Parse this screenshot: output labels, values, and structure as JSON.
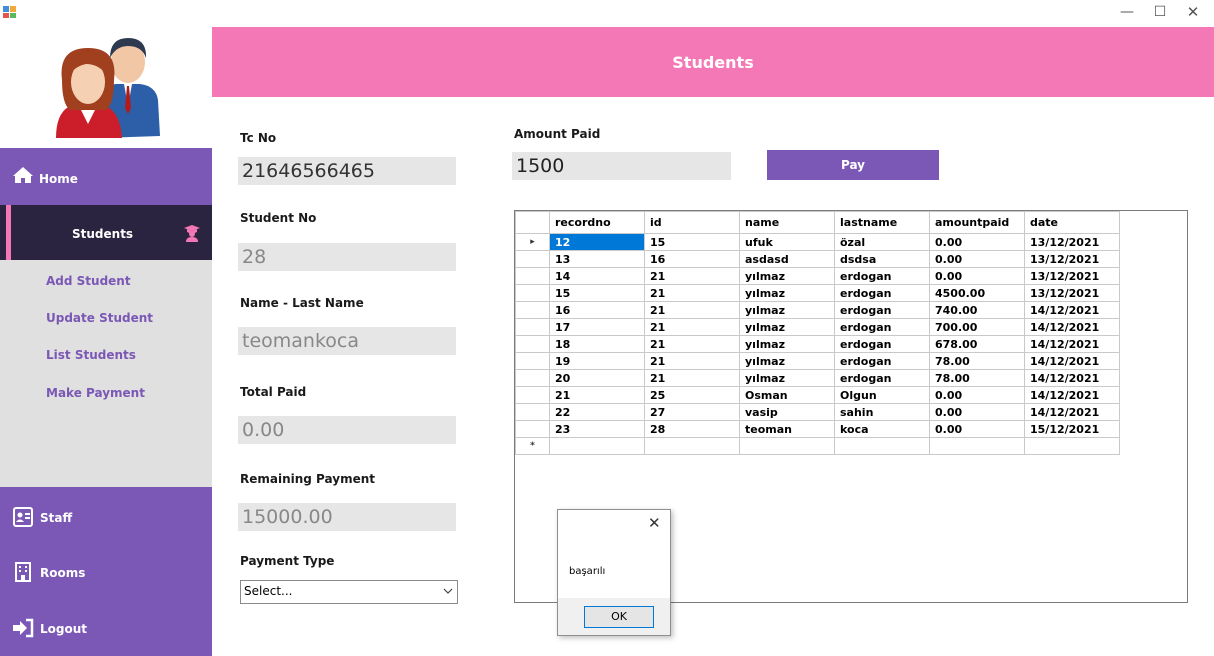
{
  "window": {
    "minimize_glyph": "—",
    "maximize_glyph": "☐",
    "close_glyph": "✕"
  },
  "header": {
    "title": "Students"
  },
  "sidebar": {
    "home": "Home",
    "students": "Students",
    "submenu": [
      "Add Student",
      "Update Student",
      "List Students",
      "Make Payment"
    ],
    "bottom": [
      "Staff",
      "Rooms",
      "Logout"
    ]
  },
  "form": {
    "tc_no_label": "Tc No",
    "tc_no_value": "21646566465",
    "student_no_label": "Student No",
    "student_no_value": "28",
    "name_label": "Name - Last Name",
    "name_value": "teomankoca",
    "total_paid_label": "Total Paid",
    "total_paid_value": "0.00",
    "remaining_label": "Remaining Payment",
    "remaining_value": "15000.00",
    "payment_type_label": "Payment Type",
    "payment_type_value": "Select...",
    "amount_paid_label": "Amount Paid",
    "amount_paid_value": "1500",
    "pay_button": "Pay"
  },
  "grid": {
    "columns": [
      "recordno",
      "id",
      "name",
      "lastname",
      "amountpaid",
      "date"
    ],
    "rows": [
      [
        "12",
        "15",
        "ufuk",
        "özal",
        "0.00",
        "13/12/2021"
      ],
      [
        "13",
        "16",
        "asdasd",
        "dsdsa",
        "0.00",
        "13/12/2021"
      ],
      [
        "14",
        "21",
        "yılmaz",
        "erdogan",
        "0.00",
        "13/12/2021"
      ],
      [
        "15",
        "21",
        "yılmaz",
        "erdogan",
        "4500.00",
        "13/12/2021"
      ],
      [
        "16",
        "21",
        "yılmaz",
        "erdogan",
        "740.00",
        "14/12/2021"
      ],
      [
        "17",
        "21",
        "yılmaz",
        "erdogan",
        "700.00",
        "14/12/2021"
      ],
      [
        "18",
        "21",
        "yılmaz",
        "erdogan",
        "678.00",
        "14/12/2021"
      ],
      [
        "19",
        "21",
        "yılmaz",
        "erdogan",
        "78.00",
        "14/12/2021"
      ],
      [
        "20",
        "21",
        "yılmaz",
        "erdogan",
        "78.00",
        "14/12/2021"
      ],
      [
        "21",
        "25",
        "Osman",
        "Olgun",
        "0.00",
        "14/12/2021"
      ],
      [
        "22",
        "27",
        "vasip",
        "sahin",
        "0.00",
        "14/12/2021"
      ],
      [
        "23",
        "28",
        "teoman",
        "koca",
        "0.00",
        "15/12/2021"
      ]
    ],
    "current_row_marker": "▸",
    "new_row_marker": "*"
  },
  "dialog": {
    "message": "başarılı",
    "ok_label": "OK",
    "close_glyph": "✕"
  },
  "colors": {
    "header": "#f478b6",
    "sidebar": "#7b58b5",
    "active_nav": "#2b2440",
    "selected_cell": "#0078d7"
  }
}
